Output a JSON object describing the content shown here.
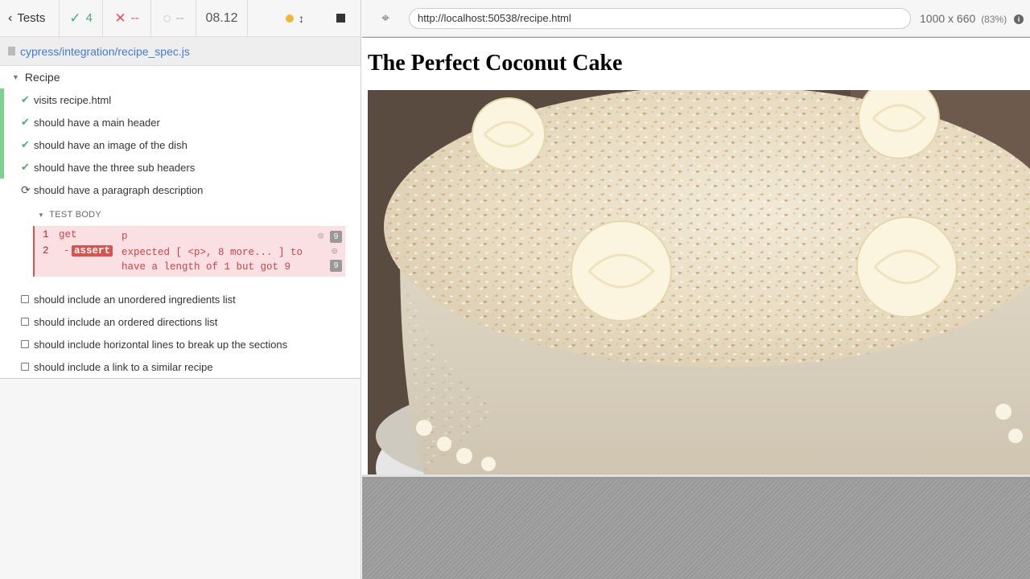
{
  "stats": {
    "tests_label": "Tests",
    "passed": "4",
    "failed": "--",
    "pending": "--",
    "duration": "08.12"
  },
  "spec": {
    "path": "cypress/integration/recipe_spec.js"
  },
  "suite": {
    "title": "Recipe"
  },
  "tests": [
    {
      "title": "visits recipe.html",
      "state": "passed"
    },
    {
      "title": "should have a main header",
      "state": "passed"
    },
    {
      "title": "should have an image of the dish",
      "state": "passed"
    },
    {
      "title": "should have the three sub headers",
      "state": "passed"
    },
    {
      "title": "should have a paragraph description",
      "state": "running"
    },
    {
      "title": "should include an unordered ingredients list",
      "state": "pending"
    },
    {
      "title": "should include an ordered directions list",
      "state": "pending"
    },
    {
      "title": "should include horizontal lines to break up the sections",
      "state": "pending"
    },
    {
      "title": "should include a link to a similar recipe",
      "state": "pending"
    }
  ],
  "test_body": {
    "label": "TEST BODY",
    "commands": [
      {
        "num": "1",
        "name": "get",
        "message": "p",
        "count": "9"
      },
      {
        "num": "2",
        "name": "assert",
        "prefix": "-",
        "message": "expected [ <p>, 8 more... ] to have a length of 1 but got 9",
        "count": "9"
      }
    ]
  },
  "aut": {
    "url": "http://localhost:50538/recipe.html",
    "viewport": "1000 x 660",
    "zoom": "(83%)",
    "page_title": "The Perfect Coconut Cake"
  },
  "colors": {
    "passed": "#4caf6f",
    "failed": "#e05555",
    "running_dot": "#f2b43e",
    "link": "#3f7bd2"
  }
}
